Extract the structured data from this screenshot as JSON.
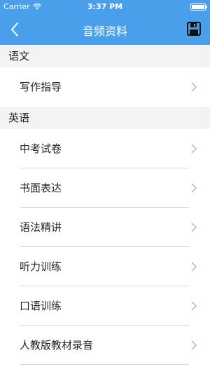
{
  "status_bar": {
    "carrier": "Carrier",
    "time": "3:37 PM"
  },
  "nav": {
    "title": "音频资料"
  },
  "sections": {
    "chinese": {
      "header": "语文",
      "items": [
        "写作指导"
      ]
    },
    "english": {
      "header": "英语",
      "items": [
        "中考试卷",
        "书面表达",
        "语法精讲",
        "听力训练",
        "口语训练",
        "人教版教材录音"
      ]
    }
  },
  "colors": {
    "accent": "#4a9fea",
    "section_bg": "#f3f3f5",
    "separator": "#d8d8dc"
  }
}
